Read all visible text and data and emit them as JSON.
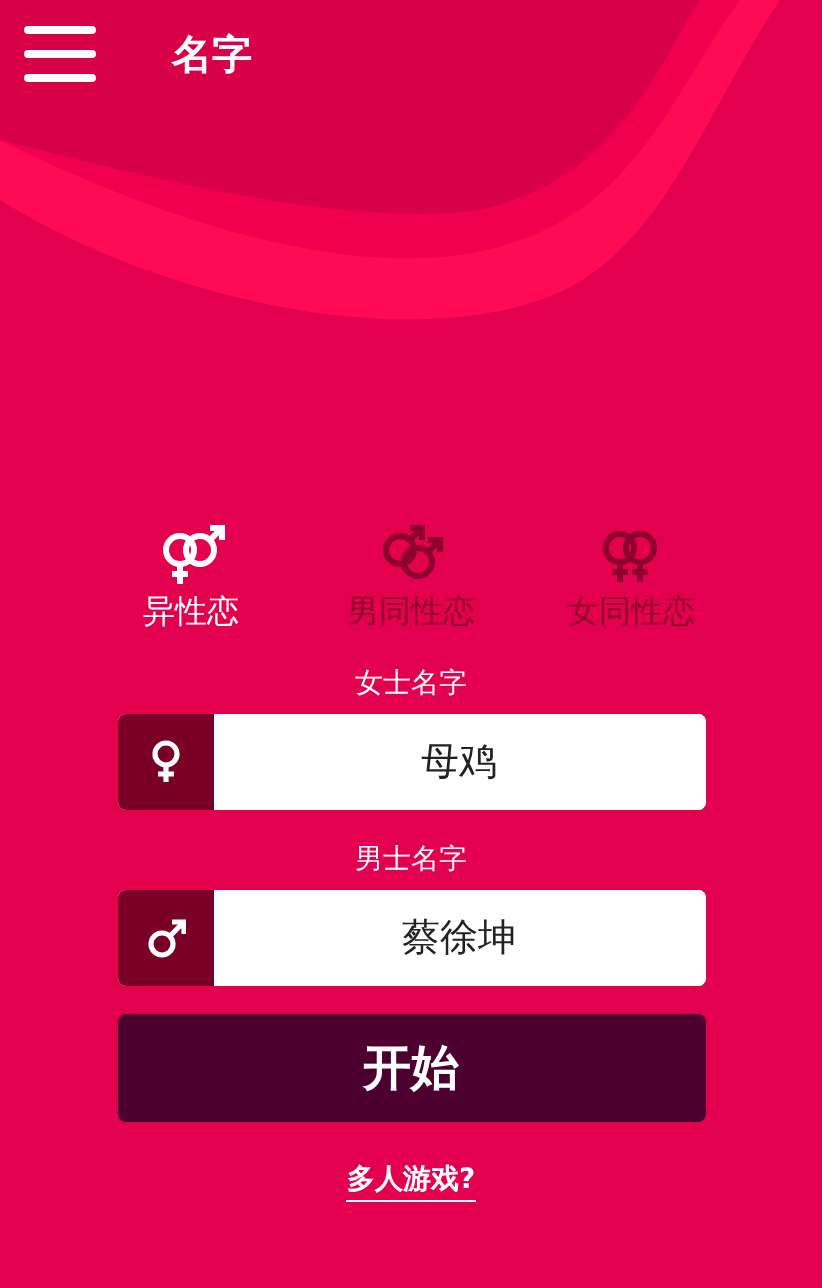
{
  "header": {
    "title": "名字"
  },
  "modes": [
    {
      "kind": "hetero",
      "label": "异性恋",
      "selected": true
    },
    {
      "kind": "gay",
      "label": "男同性恋",
      "selected": false
    },
    {
      "kind": "lesbian",
      "label": "女同性恋",
      "selected": false
    }
  ],
  "fields": [
    {
      "kind": "female",
      "label": "女士名字",
      "value": "母鸡"
    },
    {
      "kind": "male",
      "label": "男士名字",
      "value": "蔡徐坤"
    }
  ],
  "start_button": "开始",
  "multiplayer_link": "多人游戏?"
}
